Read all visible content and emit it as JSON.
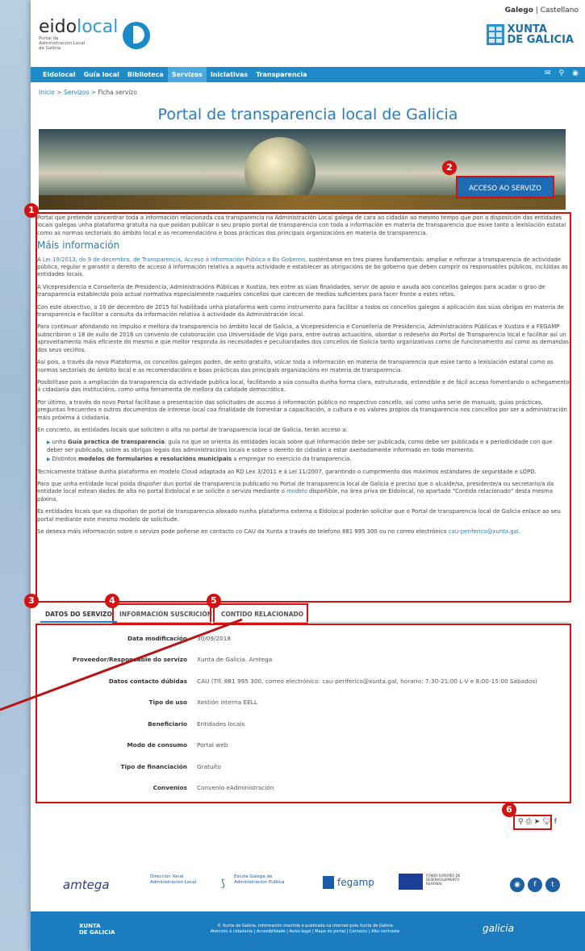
{
  "lang": {
    "gl": "Galego",
    "sep": "|",
    "es": "Castellano"
  },
  "logo": {
    "name_a": "eido",
    "name_b": "local",
    "sub": "Portal da Administración Local de Galicia"
  },
  "xunta": {
    "l1": "XUNTA",
    "l2": "DE GALICIA"
  },
  "nav": [
    "Eidolocal",
    "Guía local",
    "Biblioteca",
    "Servizos",
    "Iniciativas",
    "Transparencia"
  ],
  "breadcrumb": {
    "home": "Inicio",
    "section": "Servizos",
    "current": "Ficha servizo",
    "sep": ">"
  },
  "title": "Portal de transparencia local de Galicia",
  "acceso": "ACCESO AO SERVIZO",
  "badges": [
    "1",
    "2",
    "3",
    "4",
    "5",
    "6"
  ],
  "content": {
    "p1": "Portal que pretende concentrar toda a información relacionada coa transparencia na Administración Local galega de cara ao cidadán ao mesmo tempo que pon a disposición das entidades locais galegas unha plataforma gratuíta na que poidan publicar o seu propio portal de transparencia con toda a información en materia de transparencia que esixe tanto a lexislación estatal como as normas sectoriais do ámbito local e as recomendacións e boas prácticas das principais organizacións en materia de transparencia.",
    "heading": "Máis información",
    "p2_link": "Lei 19/2013, do 9 de decembro, de Transparencia, Acceso á Información Pública e Bo Goberno",
    "p2_pre": "A ",
    "p2_rest": ", susténtanse en tres piares fundamentais: ampliar e reforzar a transparencia de actividade pública, regular e garantir o dereito de acceso á información relativa a aquela actividade e establecer as obrigacións de bo goberno que deben cumprir os responsables públicos, incluídas as entidades locais.",
    "p3": "A Vicepresidencia e Consellería de Presidencia, Administracións Públicas e Xustiza, ten entre as súas finalidades, servir de apoio e axuda aos concellos galegos para acadar o grao de transparencia establecido pola actual normativa especialmente naqueles concellos que carecen de medios suficientes para facer fronte a estes retos.",
    "p4": "Con este obxectivo, o 10 de decembro de 2015 foi habilitada unha plataforma web como instrumento para facilitar a todos os concellos galegos a aplicación das súas obrigas en materia de transparencia e facilitar a consulta da información relativa á actividade da Administración local.",
    "p5": "Para continuar afondando no impulso e mellora da transparencia no ámbito local de Galicia, a Vicepresidencia e Consellería de Presidencia, Administracións Públicas e Xustiza e a FEGAMP subscribiron o 18 de xullo de 2016 un convenio de colaboración coa Universidade de Vigo para, entre outras actuacións, abordar o redeseño do Portal de Transparencia local e facilitar así un aproveitamento máis eficiente do mesmo e que mellor responda ás necesidades e peculiaridades dos concellos de Galicia tanto organizativas como de funcionamento así como as demandas dos seus veciños.",
    "p6": "Así pois, a través da nova Plataforma, os concellos galegos poden, de xeito gratuíto, volcar toda a información en materia de transparencia que esixe tanto a lexislación estatal como as normas sectoriais do ámbito local e as recomendacións e boas prácticas das principais organizacións en materia de transparencia.",
    "p7": "Posibilítase pois a ampliación da transparencia da actividade publica local, facilitando a súa consulta dunha forma clara, estruturada, entendible e de fácil acceso fomentando o achegamento á cidadanía das institucións, como unha ferramenta de mellora da calidade democrática.",
    "p8": "Por último, a través do novo Portal facilítase a presentación das solicitudes de acceso á información público no respectivo concello, así como unha serie de manuais, guías prácticas, preguntas frecuentes e outros documentos de interese local coa finalidade de fomentar a capacitación, a cultura e os valores propios da transparencia nos concellos por ser a administración máis próxima á cidadanía.",
    "p9": "En concreto, as entidades locais que soliciten o alta no portal de transparencia local de Galicia, terán acceso a:",
    "li1_pre": "unha ",
    "li1_b": "Guía practica de transparencia",
    "li1_rest": ": guía na que se orienta ás entidades locais sobre qué información debe ser publicada, como debe ser publicada e a periodicidade con que deber ser publicada, sobre as obrigas legais das administracións locais e sobre o dereito do cidadán a estar axeitadamente informado en todo momento.",
    "li2_pre": "Distintos ",
    "li2_b": "modelos de formularios e resolucións municipais",
    "li2_rest": " a empregar no exercicio da transparencia.",
    "p10": "Tecnicamente trátase dunha plataforma en modelo Cloud adaptada ao RD Lex 3/2011 e á Lei 11/2007, garantindo o cumprimento dos máximos estándares de seguridade e LOPD.",
    "p11_a": "Para que unha entidade local poida dispoñer dun portal de transparencia publicado no Portal de transparencia local de Galicia é preciso que o alcalde/sa, presidente/a ou secretario/a da entidade local estean dados de alta no portal Eidolocal e se solicite o servizo mediante o ",
    "p11_link": "modelo",
    "p11_b": " dispoñible, na área priva de Eidolocal, no apartado \"Contido relacionado\" desta mesma páxina.",
    "p12": "Es entidades locais que xa dispoñan de portal de transparencia aloxado nunha plataforma externa a Eidolocal poderán solicitar que o Portal de transparencia local de Galicia enlace ao seu portal mediante este mesmo modelo de solicitude.",
    "p13_a": "Se desexa máis información sobre o servizo pode poñerse en contacto co CAU da Xunta a través do telefono  881 995 300 ou no correo electrónico ",
    "p13_link": "cau-periferico@xunta.gal",
    "p13_b": "."
  },
  "tabs": [
    "DATOS DO SERVIZO",
    "INFORMACIÓN SUSCRICIÓN",
    "CONTIDO RELACIONADO"
  ],
  "details": [
    {
      "label": "Data modificación",
      "value": "30/09/2018"
    },
    {
      "label": "Proveedor/Responsable do servizo",
      "value": "Xunta de Galicia. Amtega"
    },
    {
      "label": "Datos contacto dúbidas",
      "value": "CAU (Tlf. 881 995 300, correo electrónico: cau-periferico@xunta.gal, horario: 7:30-21:00 L-V e 8:00-15:00 Sábados)"
    },
    {
      "label": "Tipo de uso",
      "value": "Xestión interna EELL"
    },
    {
      "label": "Beneficiario",
      "value": "Entidades locais"
    },
    {
      "label": "Modo de consumo",
      "value": "Portal web"
    },
    {
      "label": "Tipo de financiación",
      "value": "Gratuíto"
    },
    {
      "label": "Convenios",
      "value": "Convenio eAdministración"
    }
  ],
  "share_icons": [
    "pin-icon",
    "print-icon",
    "send-icon",
    "twitter-icon",
    "facebook-icon"
  ],
  "logos": {
    "amtega": "amtega",
    "dx": "Dirección Xeral Administración Local",
    "egap": "Escola Galega de Administración Pública",
    "fegamp": "fegamp",
    "feder": "FONDO EUROPEO DE DESENVOLVEMENTO REXIONAL"
  },
  "footer": {
    "xunta_l1": "XUNTA",
    "xunta_l2": "DE GALICIA",
    "copy": "© Xunta de Galicia. Información mantida e publicada na internet pola Xunta de Galicia",
    "links": "Atención á cidadanía | Accesibilidade | Aviso legal | Mapa do portal | Contacto | Alto contraste",
    "galicia": "galicia"
  },
  "colors": {
    "accent": "#2c7bc0",
    "nav": "#1e8bc8",
    "highlight": "#d31212",
    "footer": "#1b7cc0"
  }
}
